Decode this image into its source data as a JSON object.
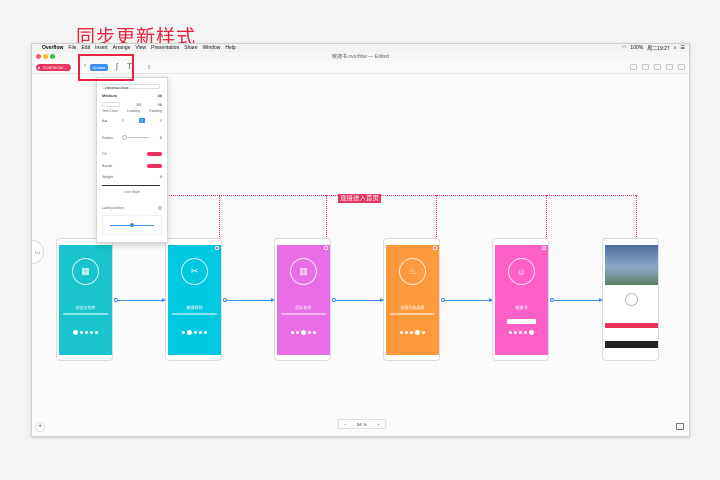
{
  "annotation": {
    "text": "同步更新样式"
  },
  "menubar": {
    "app_name": "Overflow",
    "items": [
      "File",
      "Edit",
      "Insert",
      "Arrange",
      "View",
      "Presentation",
      "Share",
      "Window",
      "Help"
    ],
    "battery": "100%",
    "clock": "周二19:27"
  },
  "window": {
    "title": "敏捷书.overflow — Edited"
  },
  "toolbar": {
    "connector_label": "Connector...",
    "update_label": "Update"
  },
  "inspector": {
    "font_name": "Helvetica Neue",
    "font_weight": "Medium",
    "font_size": "40",
    "leading": "50",
    "padding": "96",
    "labels": {
      "text_color": "Text Color",
      "leading": "Leading",
      "padding": "Padding",
      "radius": "Radius",
      "fill": "Fill",
      "border": "Border",
      "weight": "Weight",
      "line_style": "Line Style",
      "label_position": "Label position"
    },
    "radius_value": "0",
    "weight_value": "0",
    "fill_color": "#e8335c",
    "border_color": "#e8335c"
  },
  "canvas": {
    "link_label": "直接进入首页",
    "page_indicator": "1/1",
    "zoom_level": "56 %",
    "zoom_minus": "−",
    "zoom_plus": "+",
    "add_symbol": "+"
  },
  "screens": [
    {
      "color": "#19c4cc",
      "heading": "创业文档库",
      "icon": "document-icon",
      "glyph": "▦"
    },
    {
      "color": "#00c8e0",
      "heading": "敏捷规则",
      "icon": "tools-icon",
      "glyph": "✂"
    },
    {
      "color": "#e86ee8",
      "heading": "团队协作",
      "icon": "building-icon",
      "glyph": "▥"
    },
    {
      "color": "#ff9a3c",
      "heading": "创意头脑风暴",
      "icon": "cake-icon",
      "glyph": "♨"
    },
    {
      "color": "#ff60c8",
      "heading": "敏捷书",
      "icon": "cat-icon",
      "glyph": "☺"
    }
  ]
}
